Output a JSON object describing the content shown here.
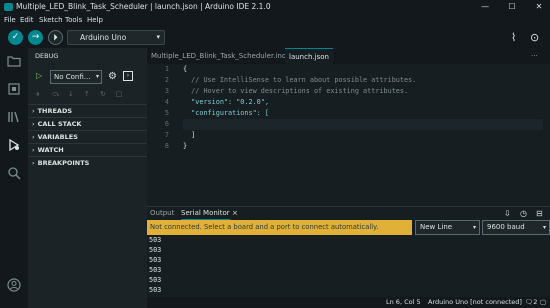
{
  "window": {
    "title": "Multiple_LED_Blink_Task_Scheduler | launch.json | Arduino IDE 2.1.0",
    "minimize": "—",
    "maximize": "☐",
    "close": "✕"
  },
  "menu": [
    "File",
    "Edit",
    "Sketch",
    "Tools",
    "Help"
  ],
  "toolbar": {
    "verify_icon": "✓",
    "upload_icon": "→",
    "debug_icon": "⏵",
    "board": "Arduino Uno",
    "plotter_icon": "⌇",
    "monitor_icon": "⊙"
  },
  "activity": [
    "sketchbook-icon",
    "boards-manager-icon",
    "library-manager-icon",
    "debug-icon",
    "search-icon",
    "account-icon"
  ],
  "debug": {
    "header": "DEBUG",
    "config": "No Confi...",
    "sections": [
      "THREADS",
      "CALL STACK",
      "VARIABLES",
      "WATCH",
      "BREAKPOINTS"
    ]
  },
  "editor": {
    "tabs": [
      "Multiple_LED_Blink_Task_Scheduler.ino",
      "launch.json"
    ],
    "active_tab": 1,
    "more": "···",
    "lines": [
      {
        "n": "1",
        "t": "{",
        "c": "br"
      },
      {
        "n": "2",
        "t": "  // Use IntelliSense to learn about possible attributes.",
        "c": "cm"
      },
      {
        "n": "3",
        "t": "  // Hover to view descriptions of existing attributes.",
        "c": "cm"
      },
      {
        "n": "4",
        "t": "  \"version\": \"0.2.0\",",
        "c": "st"
      },
      {
        "n": "5",
        "t": "  \"configurations\": [",
        "c": "st"
      },
      {
        "n": "6",
        "t": "",
        "c": "br"
      },
      {
        "n": "7",
        "t": "  ]",
        "c": "br"
      },
      {
        "n": "8",
        "t": "}",
        "c": "br"
      }
    ],
    "current_line": 6
  },
  "output": {
    "tabs": [
      "Output",
      "Serial Monitor"
    ],
    "active_tab": 1,
    "close": "×",
    "notice": "Not connected. Select a board and a port to connect automatically.",
    "line_ending": "New Line",
    "baud": "9600 baud",
    "lines": [
      "503",
      "503",
      "503",
      "503",
      "503",
      "503"
    ]
  },
  "status": {
    "position": "Ln 6, Col 5",
    "board": "Arduino Uno [not connected]",
    "notifications": "2"
  },
  "colors": {
    "accent": "#00878f",
    "warning": "#e1b137",
    "background": "#171e21"
  }
}
